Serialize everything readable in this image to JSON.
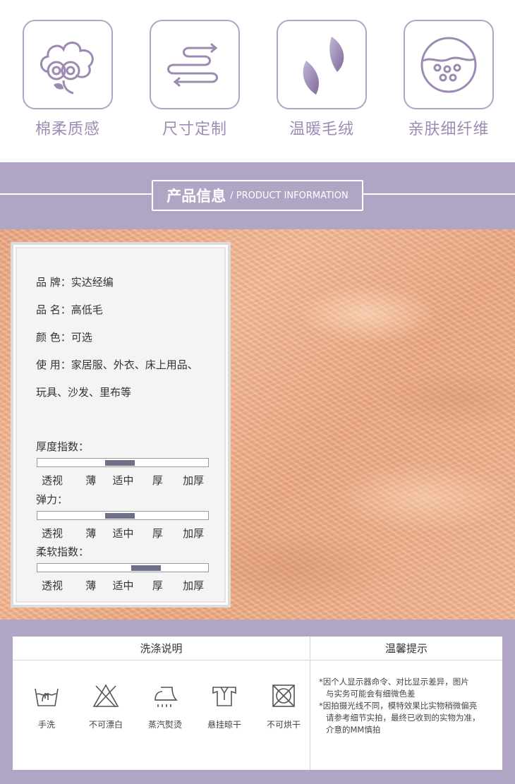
{
  "features": [
    {
      "icon": "cotton-icon",
      "label": "棉柔质感"
    },
    {
      "icon": "size-arrows-icon",
      "label": "尺寸定制"
    },
    {
      "icon": "leaves-icon",
      "label": "温暖毛绒"
    },
    {
      "icon": "fiber-icon",
      "label": "亲肤细纤维"
    }
  ],
  "section": {
    "title_cn": "产品信息",
    "title_en": "/ PRODUCT INFORMATION"
  },
  "info": {
    "brand": "品  牌：实达经编",
    "name": "品  名：高低毛",
    "color": "颜  色：可选",
    "usage_line1": "使  用：家居服、外衣、床上用品、",
    "usage_line2": "玩具、沙发、里布等"
  },
  "scales": [
    {
      "title": "厚度指数：",
      "labels": [
        "透视",
        "薄",
        "适中",
        "厚",
        "加厚"
      ],
      "selected": "适中",
      "level": 0.5
    },
    {
      "title": "弹力：",
      "labels": [
        "透视",
        "薄",
        "适中",
        "厚",
        "加厚"
      ],
      "selected": "适中",
      "level": 0.5
    },
    {
      "title": "柔软指数：",
      "labels": [
        "透视",
        "薄",
        "适中",
        "厚",
        "加厚"
      ],
      "selected": "厚",
      "level": 0.75
    }
  ],
  "care": {
    "wash_title": "洗涤说明",
    "tips_title": "温馨提示",
    "items": [
      {
        "icon": "hand-wash-icon",
        "label": "手洗"
      },
      {
        "icon": "no-bleach-icon",
        "label": "不可漂白"
      },
      {
        "icon": "steam-iron-icon",
        "label": "蒸汽熨烫"
      },
      {
        "icon": "hang-dry-icon",
        "label": "悬挂晾干"
      },
      {
        "icon": "no-tumble-dry-icon",
        "label": "不可烘干"
      }
    ],
    "tips": [
      "*因个人显示器命令、对比显示差异，图片",
      "与实务可能会有细微色差",
      "*因拍摄光线不同，模特效果比实物稍微偏亮",
      "请参考细节实拍，最终已收到的实物为准，",
      "介意的MM慎拍"
    ]
  },
  "colors": {
    "accent": "#b0a5c4",
    "icon_purple": "#9c8ab2",
    "label_purple": "#a08bb4",
    "scale_fill": "#6e7088",
    "fur": "#eeae89"
  }
}
